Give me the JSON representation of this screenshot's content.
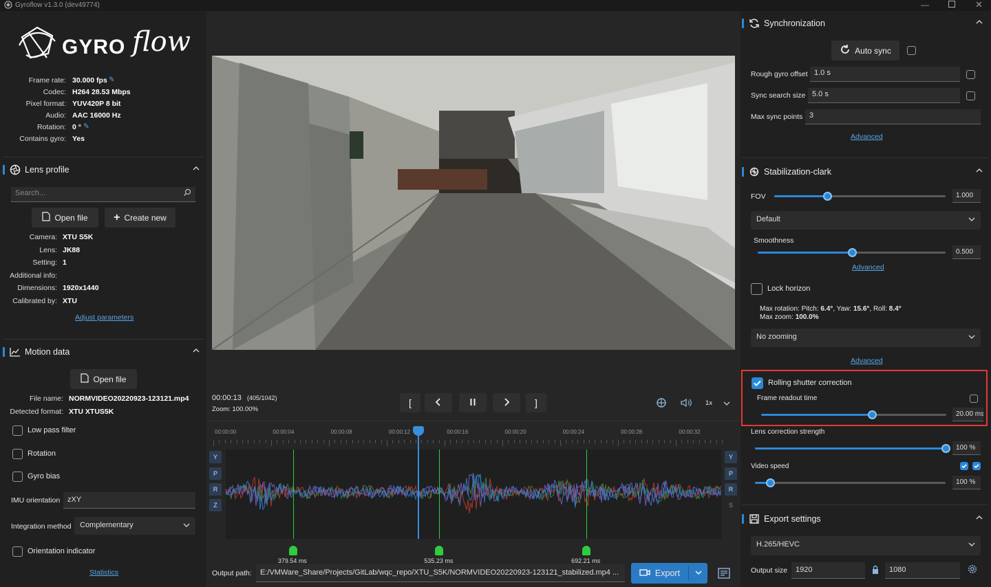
{
  "window": {
    "title": "Gyroflow v1.3.0 (dev49774)"
  },
  "logo": {
    "text": "GYRO",
    "script_text": "flow"
  },
  "video_info": [
    {
      "key": "Frame rate:",
      "value": "30.000 fps"
    },
    {
      "key": "Codec:",
      "value": "H264 28.53 Mbps"
    },
    {
      "key": "Pixel format:",
      "value": "YUV420P 8 bit"
    },
    {
      "key": "Audio:",
      "value": "AAC 16000 Hz"
    },
    {
      "key": "Rotation:",
      "value": "0 °"
    },
    {
      "key": "Contains gyro:",
      "value": "Yes"
    }
  ],
  "lens_profile": {
    "title": "Lens profile",
    "search_placeholder": "Search...",
    "open_file": "Open file",
    "create_new": "Create new",
    "info": [
      {
        "key": "Camera:",
        "value": "XTU S5K"
      },
      {
        "key": "Lens:",
        "value": "JK88"
      },
      {
        "key": "Setting:",
        "value": "1"
      },
      {
        "key": "Additional info:",
        "value": ""
      },
      {
        "key": "Dimensions:",
        "value": "1920x1440"
      },
      {
        "key": "Calibrated by:",
        "value": "XTU"
      }
    ],
    "adjust_link": "Adjust parameters"
  },
  "motion_data": {
    "title": "Motion data",
    "open_file": "Open file",
    "file_name_key": "File name:",
    "file_name": "NORMVIDEO20220923-123121.mp4",
    "format_key": "Detected format:",
    "format": "XTU XTUS5K",
    "low_pass": "Low pass filter",
    "rotation": "Rotation",
    "gyro_bias": "Gyro bias",
    "imu_label": "IMU orientation",
    "imu_value": "zXY",
    "integration_label": "Integration method",
    "integration_value": "Complementary",
    "orientation_indicator": "Orientation indicator",
    "statistics": "Statistics"
  },
  "player": {
    "timecode": "00:00:13",
    "frame": "(405/1042)",
    "zoom": "Zoom: 100.00%",
    "speed": "1x",
    "progress": 0.389
  },
  "timeline": {
    "ticks": [
      "00:00:00",
      "00:00:04",
      "00:00:08",
      "00:00:12",
      "00:00:16",
      "00:00:20",
      "00:00:24",
      "00:00:28",
      "00:00:32"
    ],
    "axes_left": [
      "Y",
      "P",
      "R",
      "Z"
    ],
    "axes_right": [
      "Y",
      "P",
      "R",
      "S"
    ],
    "markers": [
      {
        "label": "379.54 ms",
        "t": 0.136
      },
      {
        "label": "535.23 ms",
        "t": 0.431
      },
      {
        "label": "692.21 ms",
        "t": 0.728
      }
    ]
  },
  "output": {
    "label": "Output path:",
    "path": "E:/VMWare_Share/Projects/GitLab/wqc_repo/XTU_S5K/NORMVIDEO20220923-123121_stabilized.mp4 ...",
    "export": "Export"
  },
  "sync": {
    "title": "Synchronization",
    "auto_sync": "Auto sync",
    "rough_label": "Rough gyro offset",
    "rough_value": "1.0 s",
    "search_label": "Sync search size",
    "search_value": "5.0 s",
    "max_label": "Max sync points",
    "max_value": "3",
    "advanced": "Advanced"
  },
  "stab": {
    "title": "Stabilization-clark",
    "fov_label": "FOV",
    "fov_value": "1.000",
    "fov_level": 0.31,
    "method": "Default",
    "smooth_label": "Smoothness",
    "smooth_value": "0.500",
    "smooth_level": 0.5,
    "advanced": "Advanced",
    "lock_horizon": "Lock horizon",
    "max_rotation_prefix": "Max rotation: Pitch: ",
    "pitch": "6.4°",
    "yaw_prefix": ", Yaw: ",
    "yaw": "15.6°",
    "roll_prefix": ", Roll: ",
    "roll": "8.4°",
    "max_zoom_prefix": "Max zoom: ",
    "max_zoom": "100.0%",
    "zooming": "No zooming",
    "advanced2": "Advanced",
    "rs_label": "Rolling shutter correction",
    "readout_label": "Frame readout time",
    "readout_value": "20.00 ms",
    "readout_level": 0.6,
    "lens_strength_label": "Lens correction strength",
    "lens_strength_value": "100 %",
    "lens_strength_level": 1.0,
    "video_speed_label": "Video speed",
    "video_speed_value": "100 %",
    "video_speed_level": 0.08
  },
  "export_settings": {
    "title": "Export settings",
    "codec": "H.265/HEVC",
    "size_label": "Output size",
    "width": "1920",
    "height": "1080"
  },
  "colors": {
    "accent": "#2b88d8",
    "highlight_border": "#e53935",
    "marker": "#2ecc40"
  }
}
